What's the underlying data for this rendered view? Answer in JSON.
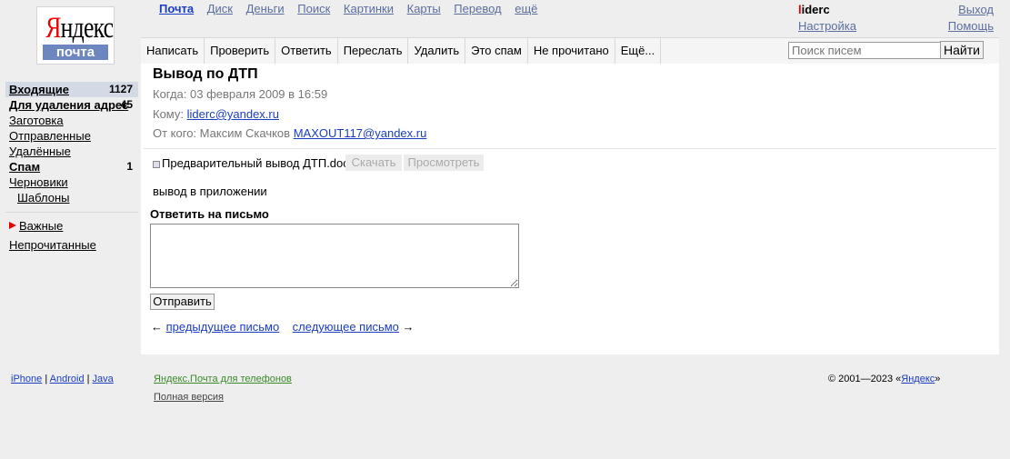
{
  "logo": {
    "wordmark_first": "Я",
    "wordmark_rest": "ндекс",
    "service": "почта"
  },
  "services": [
    {
      "label": "Почта",
      "current": true
    },
    {
      "label": "Диск"
    },
    {
      "label": "Деньги"
    },
    {
      "label": "Поиск"
    },
    {
      "label": "Картинки"
    },
    {
      "label": "Карты"
    },
    {
      "label": "Перевод"
    },
    {
      "label": "ещё"
    }
  ],
  "user": {
    "name_first": "l",
    "name_rest": "iderc",
    "settings": "Настройка",
    "logout": "Выход",
    "help": "Помощь"
  },
  "toolbar": {
    "compose": "Написать",
    "check": "Проверить",
    "reply": "Ответить",
    "forward": "Переслать",
    "delete": "Удалить",
    "spam": "Это спам",
    "unread": "Не прочитано",
    "more": "Ещё..."
  },
  "search": {
    "placeholder": "Поиск писем",
    "button": "Найти"
  },
  "folders": [
    {
      "name": "Входящие",
      "count": "1127",
      "bold": true,
      "selected": true
    },
    {
      "name": "Для удаления адрес",
      "count": "45",
      "bold": true
    },
    {
      "name": "Заготовка",
      "count": ""
    },
    {
      "name": "Отправленные",
      "count": ""
    },
    {
      "name": "Удалённые",
      "count": ""
    },
    {
      "name": "Спам",
      "count": "1",
      "bold": true
    },
    {
      "name": "Черновики",
      "count": ""
    },
    {
      "name": "Шаблоны",
      "count": "",
      "sub": true
    }
  ],
  "labels": {
    "important": "Важные",
    "unread": "Непрочитанные"
  },
  "message": {
    "subject": "Вывод по ДТП",
    "when_label": "Когда:",
    "when": "03 февраля 2009 в 16:59",
    "to_label": "Кому:",
    "to": "liderc@yandex.ru",
    "from_label": "От кого:",
    "from_name": "Максим Скачков",
    "from_email": "MAXOUT117@yandex.ru",
    "attachment": "Предварительный вывод ДТП.doc",
    "download": "Скачать",
    "preview": "Просмотреть",
    "body": "вывод в приложении"
  },
  "reply": {
    "title": "Ответить на письмо",
    "send": "Отправить"
  },
  "nav": {
    "prev_arrow": "←",
    "prev": "предыдущее письмо",
    "next": "следующее письмо",
    "next_arrow": "→"
  },
  "footer": {
    "iphone": "iPhone",
    "android": "Android",
    "java": "Java",
    "sep": "|",
    "mobile": "Яндекс.Почта для телефонов",
    "full": "Полная версия",
    "copyright_prefix": "© 2001—2023 «",
    "copyright_link": "Яндекс",
    "copyright_suffix": "»"
  },
  "colors": {
    "accent": "#1a3dc1",
    "brand_red": "#ee0000",
    "selected_folder": "#d4d9e6"
  }
}
